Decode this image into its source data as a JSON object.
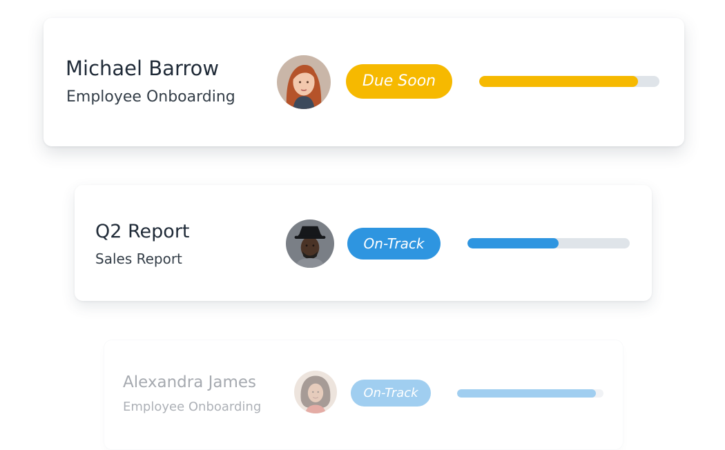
{
  "cards": [
    {
      "name": "Michael Barrow",
      "subtitle": "Employee Onboarding",
      "status": "Due Soon",
      "status_color": "#f6b900",
      "progress": 0.88,
      "avatar": "woman-red-hair-avatar"
    },
    {
      "name": "Q2 Report",
      "subtitle": "Sales Report",
      "status": "On-Track",
      "status_color": "#2e95e0",
      "progress": 0.56,
      "avatar": "man-black-hat-avatar"
    },
    {
      "name": "Alexandra James",
      "subtitle": "Employee Onboarding",
      "status": "On-Track",
      "status_color": "#2e95e0",
      "progress": 0.95,
      "avatar": "woman-curly-hair-avatar"
    }
  ],
  "track_color": "#dfe4e9"
}
